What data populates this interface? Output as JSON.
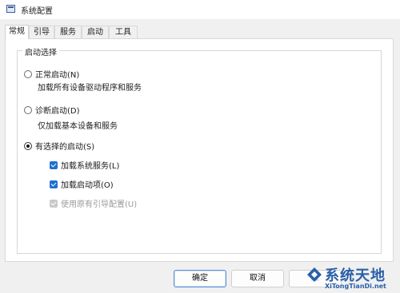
{
  "window": {
    "title": "系统配置"
  },
  "tabs": [
    {
      "label": "常规",
      "active": true
    },
    {
      "label": "引导",
      "active": false
    },
    {
      "label": "服务",
      "active": false
    },
    {
      "label": "启动",
      "active": false
    },
    {
      "label": "工具",
      "active": false
    }
  ],
  "startup": {
    "group_label": "启动选择",
    "options": [
      {
        "label": "正常启动(N)",
        "description": "加载所有设备驱动程序和服务",
        "selected": false
      },
      {
        "label": "诊断启动(D)",
        "description": "仅加载基本设备和服务",
        "selected": false
      },
      {
        "label": "有选择的启动(S)",
        "selected": true
      }
    ],
    "selective_items": [
      {
        "label": "加载系统服务(L)",
        "checked": true,
        "enabled": true
      },
      {
        "label": "加载启动项(O)",
        "checked": true,
        "enabled": true
      },
      {
        "label": "使用原有引导配置(U)",
        "checked": true,
        "enabled": false
      }
    ]
  },
  "buttons": {
    "ok": "确定",
    "cancel": "取消",
    "apply": "应"
  },
  "watermark": {
    "name": "系统天地",
    "url": "XiTongTianDi.net"
  },
  "colors": {
    "accent": "#1f6fd1",
    "watermark": "#2a5fa8"
  }
}
